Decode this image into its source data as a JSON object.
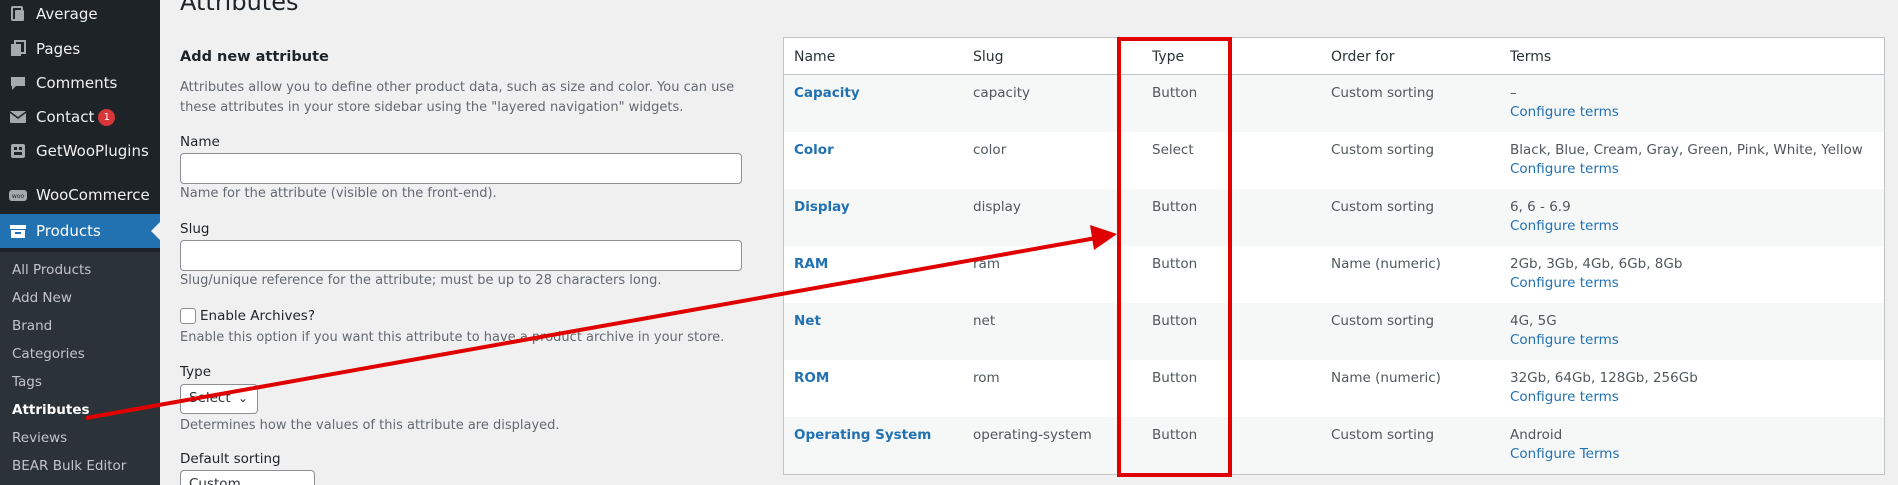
{
  "sidebar": {
    "menu": [
      {
        "label": "Average",
        "icon": "page-icon"
      },
      {
        "label": "Pages",
        "icon": "pages-icon"
      },
      {
        "label": "Comments",
        "icon": "comment-icon"
      },
      {
        "label": "Contact",
        "icon": "mail-icon",
        "badge": "1"
      },
      {
        "label": "GetWooPlugins",
        "icon": "plugin-icon"
      },
      {
        "label": "WooCommerce",
        "icon": "woo-icon"
      },
      {
        "label": "Products",
        "icon": "archive-icon"
      }
    ],
    "submenu": [
      "All Products",
      "Add New",
      "Brand",
      "Categories",
      "Tags",
      "Attributes",
      "Reviews",
      "BEAR Bulk Editor"
    ]
  },
  "page": {
    "title": "Attributes"
  },
  "form": {
    "title": "Add new attribute",
    "intro": "Attributes allow you to define other product data, such as size and color. You can use these attributes in your store sidebar using the \"layered navigation\" widgets.",
    "name_label": "Name",
    "name_value": "",
    "name_help": "Name for the attribute (visible on the front-end).",
    "slug_label": "Slug",
    "slug_value": "",
    "slug_help": "Slug/unique reference for the attribute; must be up to 28 characters long.",
    "archives_label": "Enable Archives?",
    "archives_help": "Enable this option if you want this attribute to have a product archive in your store.",
    "type_label": "Type",
    "type_value": "Select",
    "type_help": "Determines how the values of this attribute are displayed.",
    "sorting_label": "Default sorting",
    "sorting_value": "Custom sorting"
  },
  "table": {
    "headers": [
      "Name",
      "Slug",
      "Type",
      "Order for",
      "Terms"
    ],
    "rows": [
      {
        "name": "Capacity",
        "slug": "capacity",
        "type": "Button",
        "order": "Custom sorting",
        "terms": "–",
        "configure": "Configure terms"
      },
      {
        "name": "Color",
        "slug": "color",
        "type": "Select",
        "order": "Custom sorting",
        "terms": "Black, Blue, Cream, Gray, Green, Pink, White, Yellow",
        "configure": "Configure terms"
      },
      {
        "name": "Display",
        "slug": "display",
        "type": "Button",
        "order": "Custom sorting",
        "terms": "6, 6 - 6.9",
        "configure": "Configure terms"
      },
      {
        "name": "RAM",
        "slug": "ram",
        "type": "Button",
        "order": "Name (numeric)",
        "terms": "2Gb, 3Gb, 4Gb, 6Gb, 8Gb",
        "configure": "Configure terms"
      },
      {
        "name": "Net",
        "slug": "net",
        "type": "Button",
        "order": "Custom sorting",
        "terms": "4G, 5G",
        "configure": "Configure terms"
      },
      {
        "name": "ROM",
        "slug": "rom",
        "type": "Button",
        "order": "Name (numeric)",
        "terms": "32Gb, 64Gb, 128Gb, 256Gb",
        "configure": "Configure terms"
      },
      {
        "name": "Operating System",
        "slug": "operating-system",
        "type": "Button",
        "order": "Custom sorting",
        "terms": "Android",
        "configure": "Configure Terms"
      }
    ]
  },
  "colors": {
    "admin_bar": "#1d2327",
    "accent": "#2271b1",
    "annotation": "#e00000",
    "badge": "#d63638"
  }
}
